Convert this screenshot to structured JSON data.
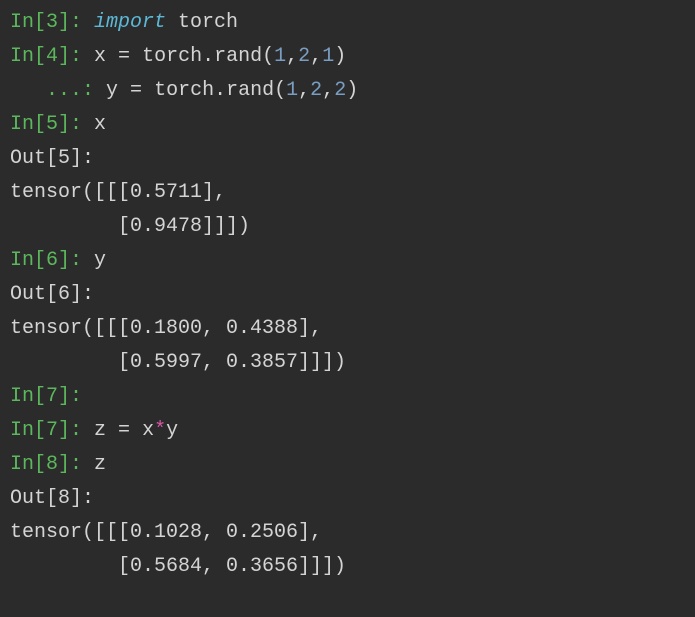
{
  "lines": {
    "l1": {
      "prompt": "In[3]: ",
      "kw": "import",
      "sp1": " ",
      "mod": "torch"
    },
    "l2": {
      "prompt": "In[4]: ",
      "v": "x",
      "sp1": " ",
      "op": "=",
      "sp2": " ",
      "f": "torch.rand",
      "p1": "(",
      "n1": "1",
      "c1": ",",
      "n2": "2",
      "c2": ",",
      "n3": "1",
      "p2": ")"
    },
    "l3": {
      "prompt": "   ...: ",
      "v": "y",
      "sp1": " ",
      "op": "=",
      "sp2": " ",
      "f": "torch.rand",
      "p1": "(",
      "n1": "1",
      "c1": ",",
      "n2": "2",
      "c2": ",",
      "n3": "2",
      "p2": ")"
    },
    "l4": {
      "prompt": "In[5]: ",
      "v": "x"
    },
    "l5": {
      "prompt": "Out[5]:"
    },
    "l6": {
      "t": "tensor([[[0.5711],"
    },
    "l7": {
      "t": "         [0.9478]]])"
    },
    "l8": {
      "prompt": "In[6]: ",
      "v": "y"
    },
    "l9": {
      "prompt": "Out[6]:"
    },
    "l10": {
      "t": "tensor([[[0.1800, 0.4388],"
    },
    "l11": {
      "t": "         [0.5997, 0.3857]]])"
    },
    "l12": {
      "prompt": "In[7]:"
    },
    "l13": {
      "prompt": "In[7]: ",
      "v": "z",
      "sp1": " ",
      "op": "=",
      "sp2": " ",
      "lhs": "x",
      "star": "*",
      "rhs": "y"
    },
    "l14": {
      "prompt": "In[8]: ",
      "v": "z"
    },
    "l15": {
      "prompt": "Out[8]:"
    },
    "l16": {
      "t": "tensor([[[0.1028, 0.2506],"
    },
    "l17": {
      "t": "         [0.5684, 0.3656]]])"
    }
  }
}
